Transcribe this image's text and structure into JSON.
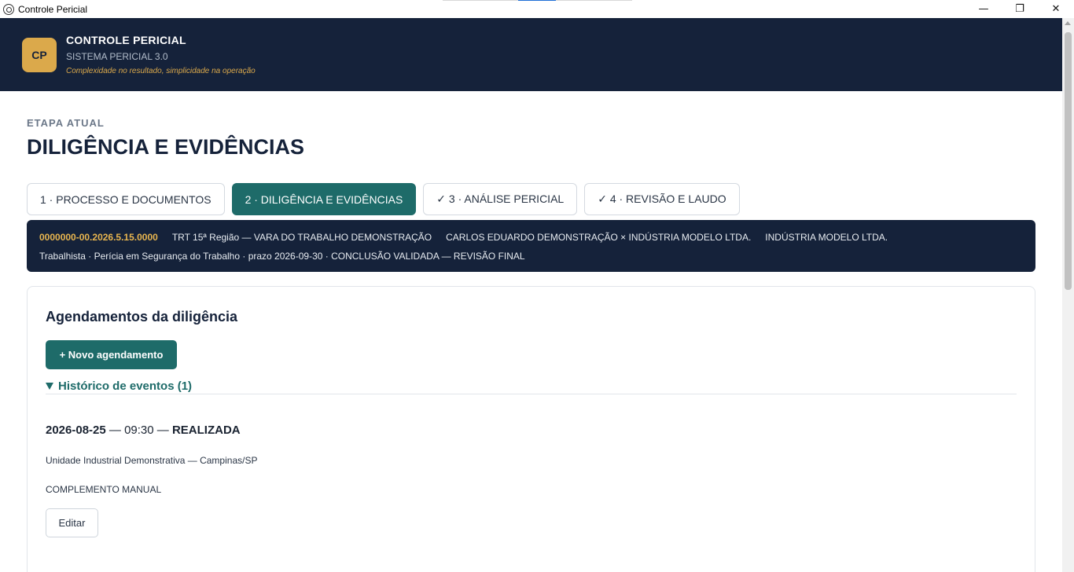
{
  "window": {
    "title": "Controle Pericial",
    "minimize": "—",
    "restore": "❐",
    "close": "✕"
  },
  "header": {
    "logo": "CP",
    "brand_name": "CONTROLE PERICIAL",
    "subtitle": "SISTEMA PERICIAL 3.0",
    "tagline": "Complexidade no resultado, simplicidade na operação"
  },
  "stage": {
    "label": "ETAPA ATUAL",
    "title": "DILIGÊNCIA E EVIDÊNCIAS"
  },
  "tabs": [
    {
      "label": "1 · PROCESSO E DOCUMENTOS",
      "active": false
    },
    {
      "label": "2 · DILIGÊNCIA E EVIDÊNCIAS",
      "active": true
    },
    {
      "label": "✓ 3 · ANÁLISE PERICIAL",
      "active": false
    },
    {
      "label": "✓ 4 · REVISÃO E LAUDO",
      "active": false
    }
  ],
  "case": {
    "process_number": "0000000-00.2026.5.15.0000",
    "court": "TRT 15ª Região — VARA DO TRABALHO DEMONSTRAÇÃO",
    "parties": "CARLOS EDUARDO DEMONSTRAÇÃO × INDÚSTRIA MODELO LTDA.",
    "company": "INDÚSTRIA MODELO LTDA.",
    "details": "Trabalhista · Perícia em Segurança do Trabalho · prazo 2026-09-30 · CONCLUSÃO VALIDADA — REVISÃO FINAL"
  },
  "schedules": {
    "title": "Agendamentos da diligência",
    "new_button": "+ Novo agendamento",
    "history_label": "Histórico de eventos (1)",
    "event": {
      "date": "2026-08-25",
      "sep1": " — ",
      "time": "09:30",
      "sep2": " — ",
      "status": "REALIZADA",
      "location": "Unidade Industrial Demonstrativa — Campinas/SP",
      "note": "COMPLEMENTO MANUAL",
      "edit_button": "Editar"
    }
  },
  "colors": {
    "header_bg": "#15223a",
    "accent_gold": "#dba94b",
    "accent_teal": "#1e6b69"
  }
}
